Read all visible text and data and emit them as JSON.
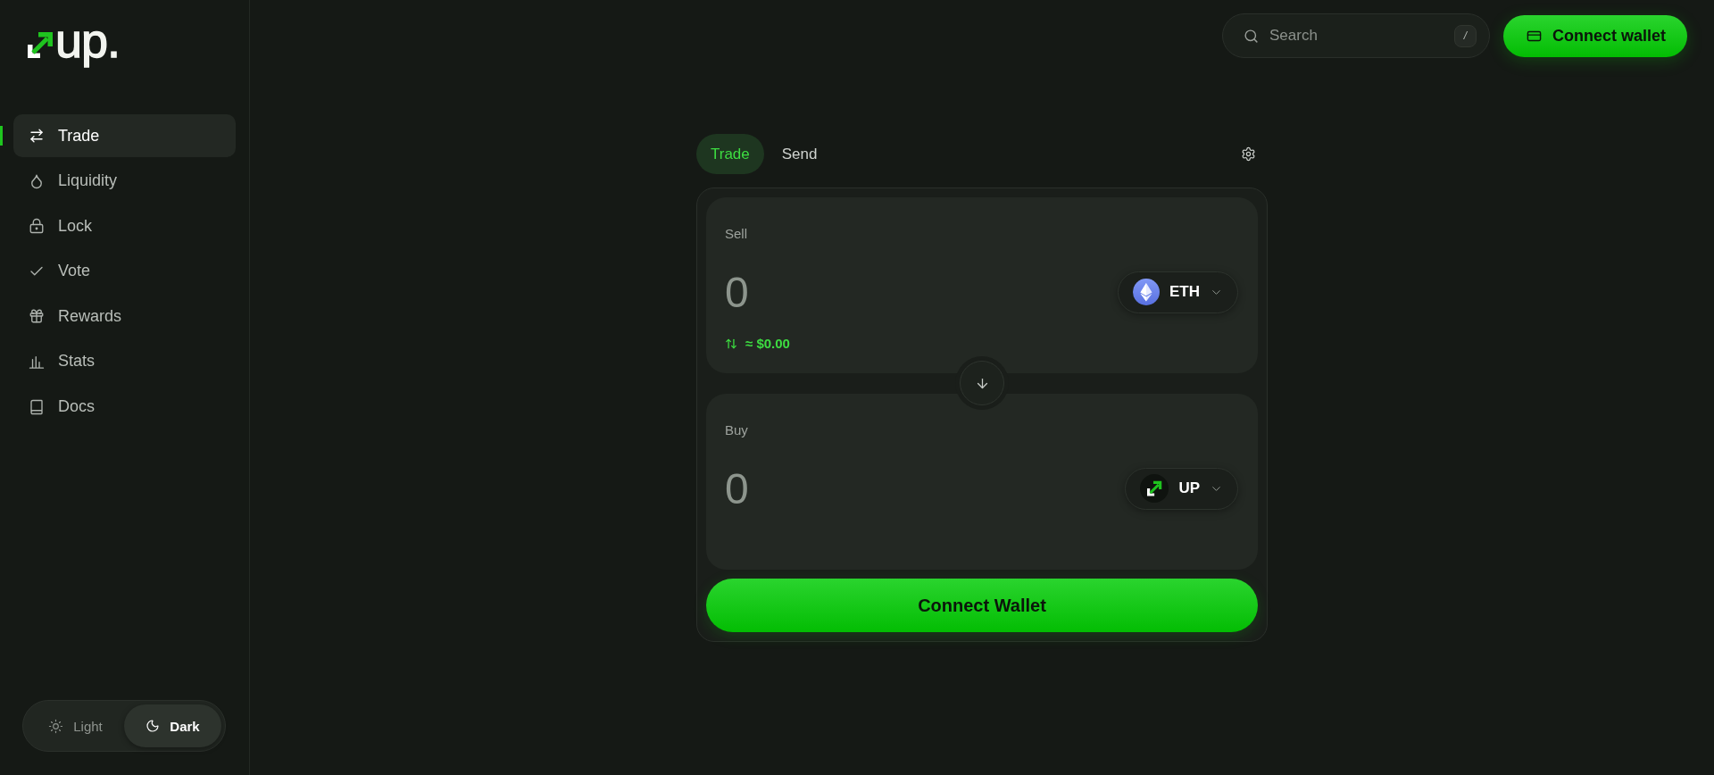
{
  "logo": {
    "text": "up."
  },
  "sidebar": {
    "items": [
      {
        "label": "Trade",
        "selected": true
      },
      {
        "label": "Liquidity",
        "selected": false
      },
      {
        "label": "Lock",
        "selected": false
      },
      {
        "label": "Vote",
        "selected": false
      },
      {
        "label": "Rewards",
        "selected": false
      },
      {
        "label": "Stats",
        "selected": false
      },
      {
        "label": "Docs",
        "selected": false
      }
    ]
  },
  "theme_toggle": {
    "options": [
      {
        "label": "Light",
        "selected": false
      },
      {
        "label": "Dark",
        "selected": true
      }
    ]
  },
  "header": {
    "search": {
      "placeholder": "Search",
      "shortcut": "/"
    },
    "connect_button": {
      "label": "Connect wallet"
    }
  },
  "swap": {
    "tabs": [
      {
        "label": "Trade",
        "selected": true
      },
      {
        "label": "Send",
        "selected": false
      }
    ],
    "panels": [
      {
        "label": "Sell",
        "placeholder": "0",
        "token": "ETH",
        "usd_value": "≈ $0.00"
      },
      {
        "label": "Buy",
        "placeholder": "0",
        "token": "UP"
      }
    ],
    "submit_button": {
      "label": "Connect Wallet"
    }
  }
}
